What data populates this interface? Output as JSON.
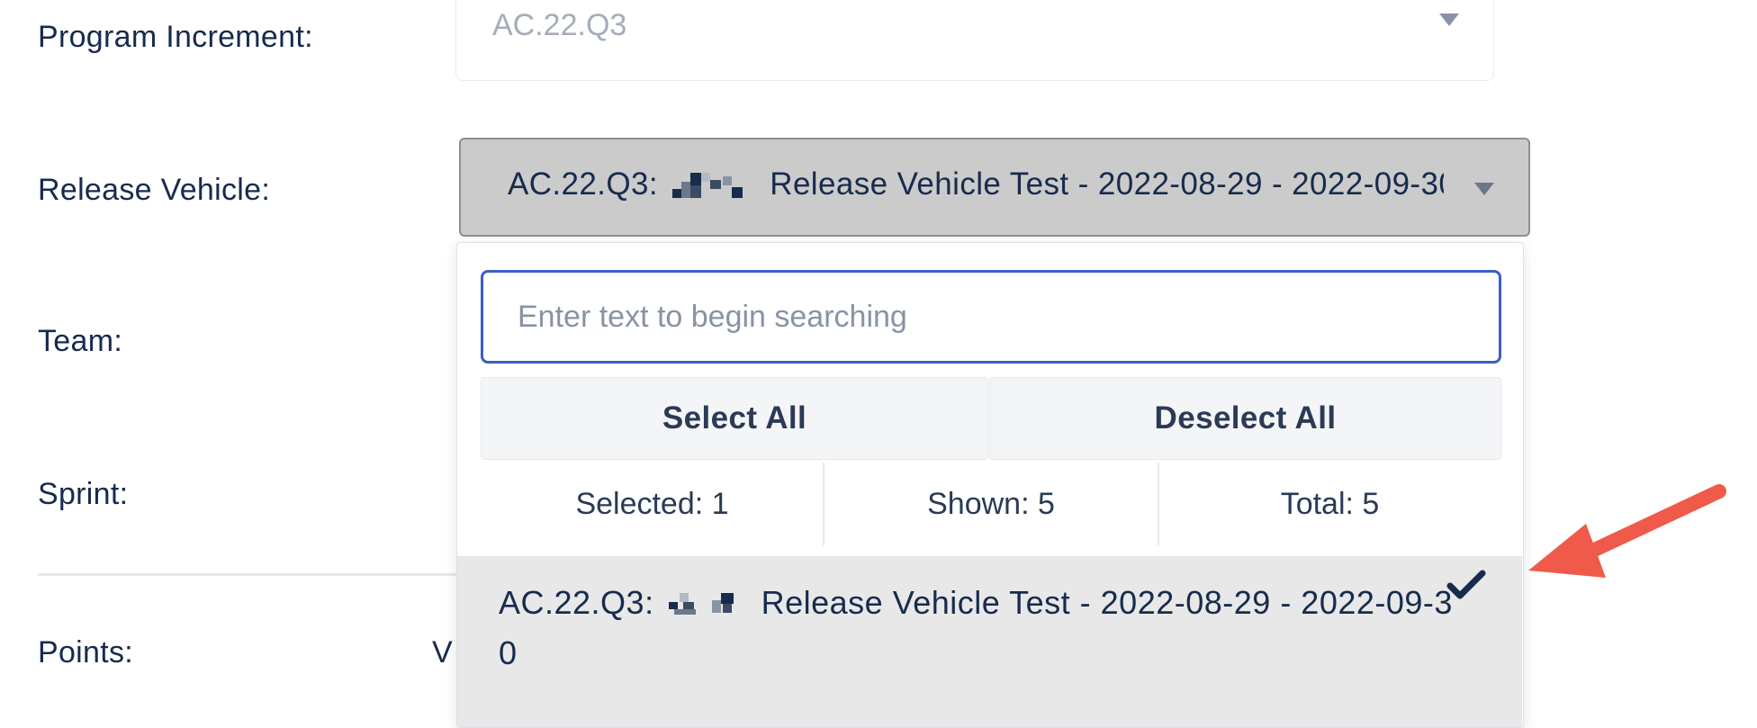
{
  "form": {
    "labels": {
      "program_increment": "Program Increment:",
      "release_vehicle": "Release Vehicle:",
      "team": "Team:",
      "sprint": "Sprint:",
      "points": "Points:"
    },
    "points_trailing_text": "V",
    "program_increment_value": "AC.22.Q3",
    "release_vehicle_value_prefix": "AC.22.Q3:",
    "release_vehicle_value_suffix": "Release Vehicle Test - 2022-08-29 - 2022-09-30"
  },
  "dropdown": {
    "search_placeholder": "Enter text to begin searching",
    "select_all_label": "Select All",
    "deselect_all_label": "Deselect All",
    "selected_text": "Selected: 1",
    "shown_text": "Shown: 5",
    "total_text": "Total: 5",
    "options": [
      {
        "prefix": "AC.22.Q3:",
        "suffix": "Release Vehicle Test - 2022-08-29 - 2022-09-30",
        "selected": true
      }
    ]
  },
  "icons": {
    "caret": "chevron-down-icon",
    "check": "check-icon",
    "annotation": "red-arrow"
  },
  "colors": {
    "accent_focus": "#3b5fc8",
    "selected_option_bg": "#e8e8e8",
    "annotation_arrow": "#ef5a4a",
    "text": "#172b4d"
  }
}
